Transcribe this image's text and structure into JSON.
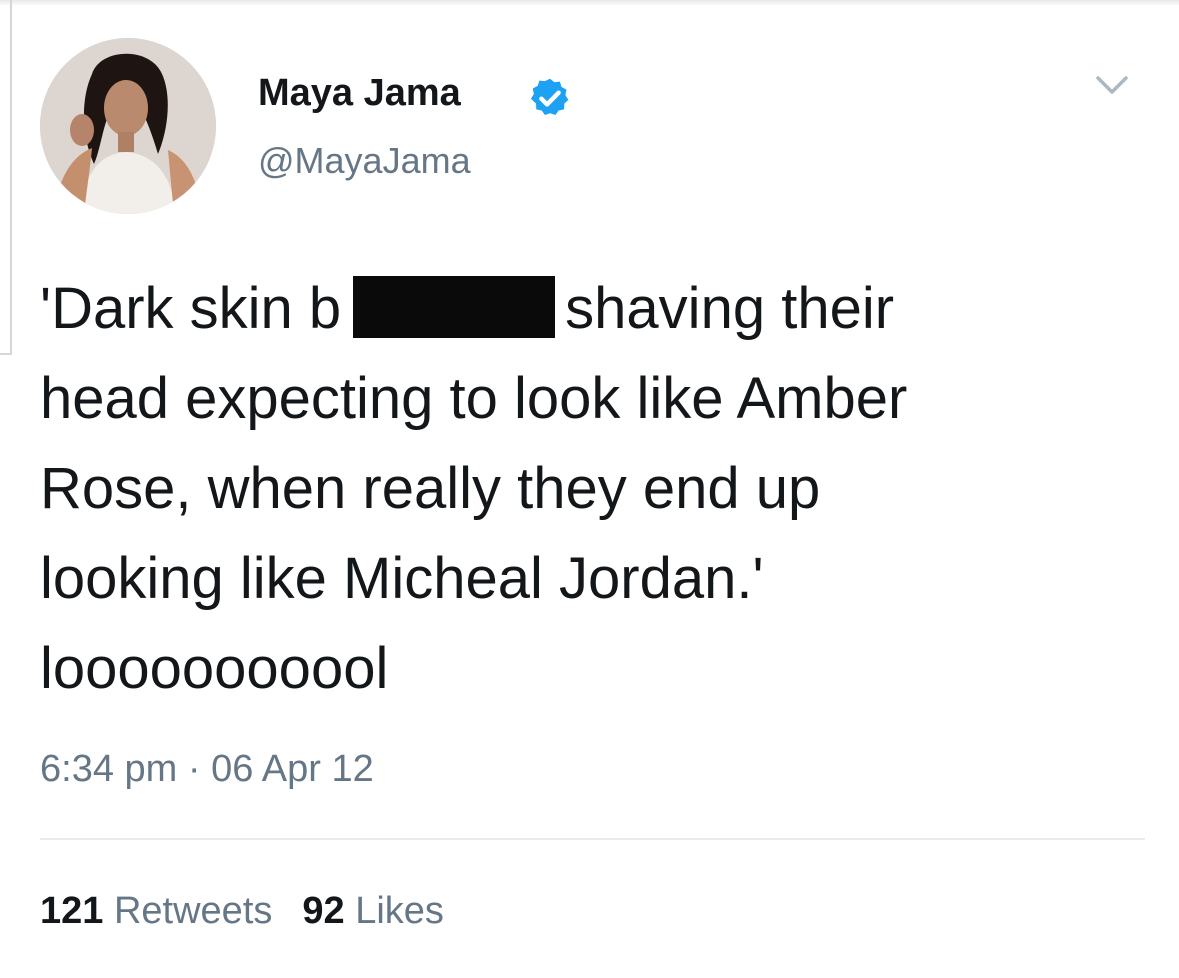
{
  "user": {
    "display_name": "Maya Jama",
    "handle": "@MayaJama",
    "verified": true,
    "avatar_icon": "profile-photo"
  },
  "tweet": {
    "line1_before": "'Dark skin b",
    "line1_after": "shaving their",
    "line2": "head expecting to look like Amber",
    "line3": "Rose, when really they end up",
    "line4": "looking like Micheal Jordan.'",
    "line5": "looooooooool",
    "timestamp": "6:34 pm · 06 Apr 12"
  },
  "stats": {
    "retweets_count": "121",
    "retweets_label": "Retweets",
    "likes_count": "92",
    "likes_label": "Likes"
  },
  "colors": {
    "text": "#14171a",
    "secondary": "#657786",
    "verified_blue": "#1da1f2",
    "divider": "#e6ecf0",
    "redaction": "#0a0a0a"
  },
  "icons": {
    "menu": "chevron-down-icon",
    "verified": "verified-badge-icon"
  }
}
